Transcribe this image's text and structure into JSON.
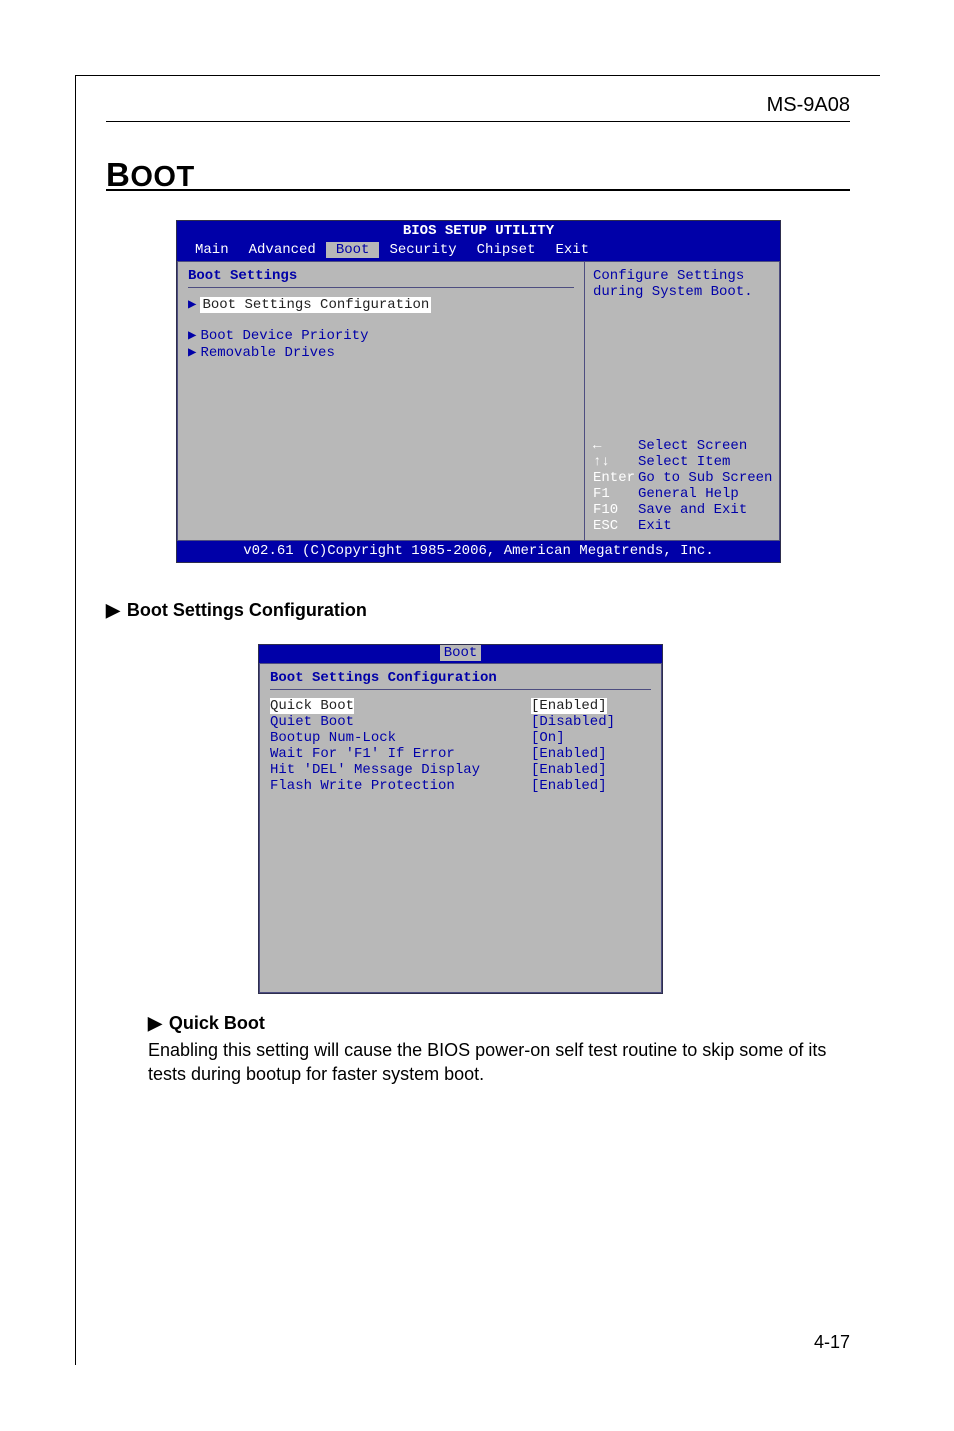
{
  "header": {
    "label": "MS-9A08"
  },
  "section": {
    "title_cap": "B",
    "title_rest": "OOT"
  },
  "bios1": {
    "title": "BIOS SETUP UTILITY",
    "tabs": [
      "Main",
      "Advanced",
      "Boot",
      "Security",
      "Chipset",
      "Exit"
    ],
    "selected_tab_index": 2,
    "left_heading": "Boot Settings",
    "items": [
      {
        "label": "Boot Settings Configuration",
        "selected": true
      },
      {
        "label": "Boot Device Priority",
        "selected": false
      },
      {
        "label": "Removable Drives",
        "selected": false
      }
    ],
    "help_top_1": "Configure Settings",
    "help_top_2": "during System Boot.",
    "keys": [
      {
        "k": "←",
        "d": "Select Screen"
      },
      {
        "k": "↑↓",
        "d": "Select Item"
      },
      {
        "k": "Enter",
        "d": "Go to Sub Screen"
      },
      {
        "k": "F1",
        "d": "General Help"
      },
      {
        "k": "F10",
        "d": "Save and Exit"
      },
      {
        "k": "ESC",
        "d": "Exit"
      }
    ],
    "footer": "v02.61 (C)Copyright 1985-2006, American Megatrends, Inc."
  },
  "subsection1": {
    "triangle": "▶",
    "title": "Boot Settings Configuration"
  },
  "bios2": {
    "tab": "Boot",
    "heading": "Boot Settings Configuration",
    "rows": [
      {
        "label": "Quick Boot",
        "value": "[Enabled]",
        "selected": true
      },
      {
        "label": "Quiet Boot",
        "value": "[Disabled]",
        "selected": false
      },
      {
        "label": "Bootup Num-Lock",
        "value": "[On]",
        "selected": false
      },
      {
        "label": "Wait For 'F1' If Error",
        "value": "[Enabled]",
        "selected": false
      },
      {
        "label": "Hit 'DEL' Message Display",
        "value": "[Enabled]",
        "selected": false
      },
      {
        "label": "Flash Write Protection",
        "value": "[Enabled]",
        "selected": false
      }
    ]
  },
  "subsection2": {
    "triangle": "▶",
    "title": "Quick Boot"
  },
  "paragraph": "Enabling this setting will cause the BIOS power-on self test routine to skip some of its tests during bootup for faster system boot.",
  "page_number": "4-17"
}
